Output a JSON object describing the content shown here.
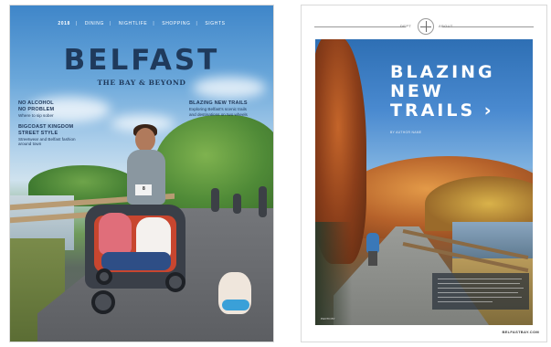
{
  "cover": {
    "nav": [
      "2018",
      "DINING",
      "NIGHTLIFE",
      "SHOPPING",
      "SIGHTS"
    ],
    "title": "BELFAST",
    "subtitle": "THE BAY & BEYOND",
    "stories": [
      {
        "heading": "NO ALCOHOL",
        "heading2": "NO PROBLEM",
        "sub": "Where to sip sober"
      },
      {
        "heading": "BIGCOAST KINGDOM",
        "heading2": "STREET STYLE",
        "sub": "Streetwear and Belfast fashion",
        "sub2": "around town"
      },
      {
        "heading": "BLAZING NEW TRAILS",
        "sub": "Exploring Belfast's scenic trails",
        "sub2": "and destinations on two wheels"
      }
    ],
    "bib_number": "8"
  },
  "spread": {
    "header_left": "DEPT",
    "header_right": "ABOUT",
    "headline_lines": [
      "BLAZING",
      "NEW",
      "TRAILS ›"
    ],
    "byline": "BY AUTHOR NAME",
    "photo_credit": "PHOTO BY",
    "footer": "BELFASTBAY.COM"
  }
}
